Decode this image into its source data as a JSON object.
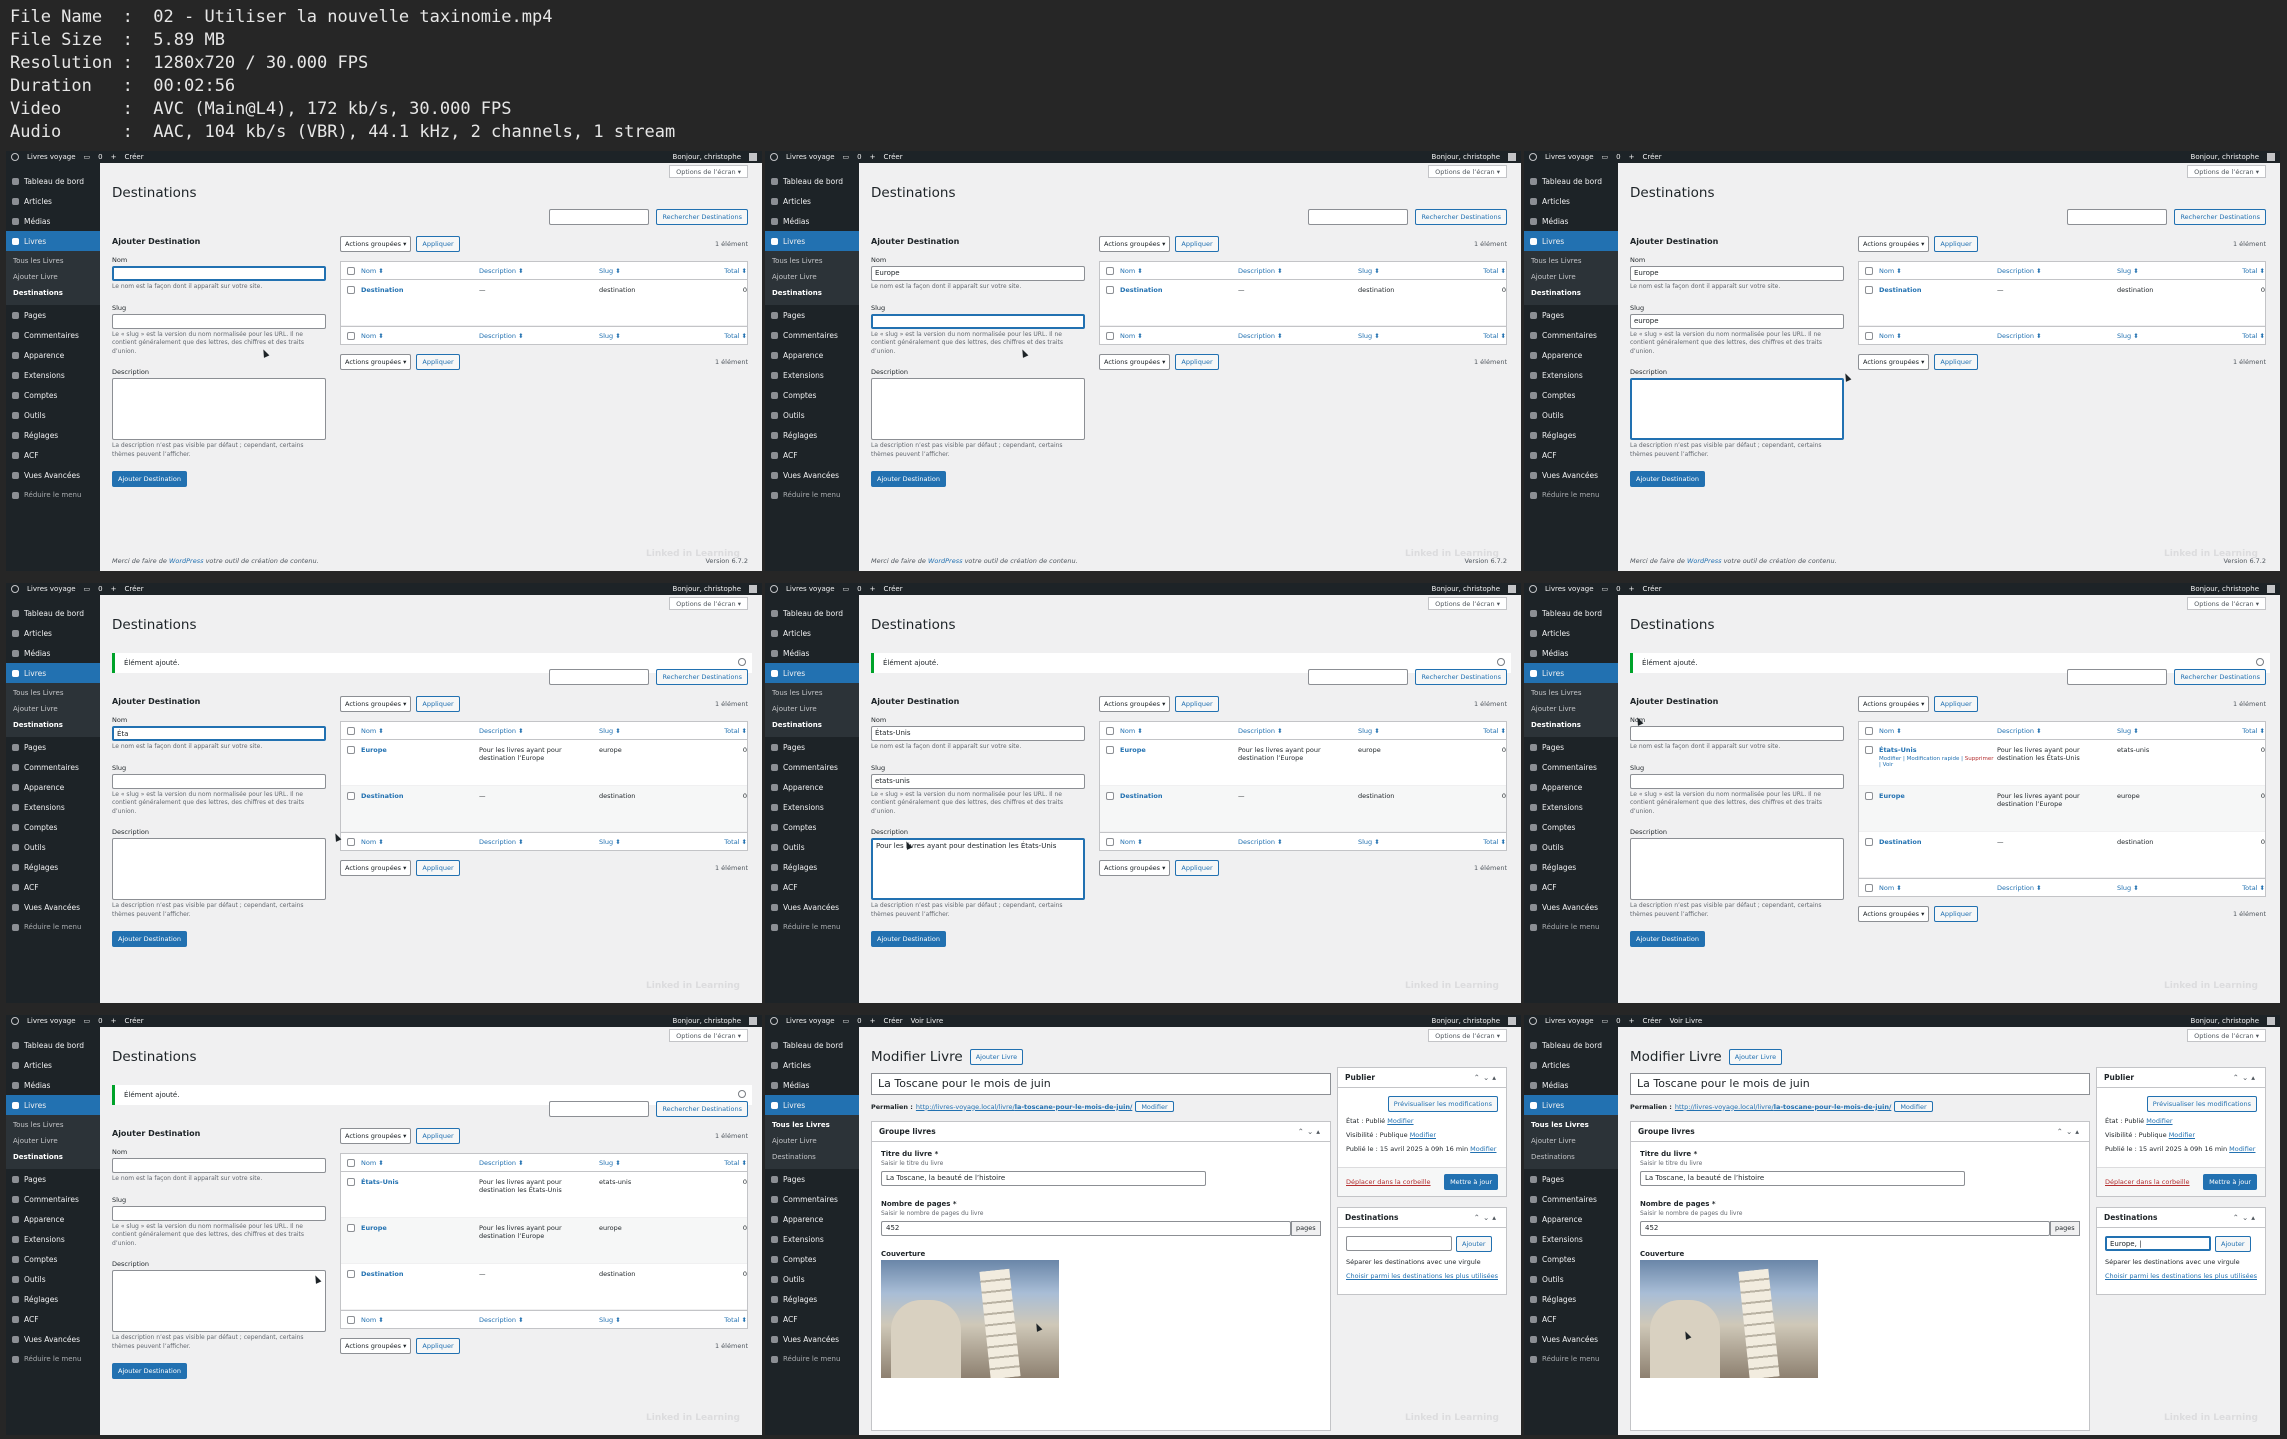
{
  "file_info": [
    {
      "label": "File Name",
      "value": "02 - Utiliser la nouvelle taxinomie.mp4"
    },
    {
      "label": "File Size",
      "value": "5.89 MB"
    },
    {
      "label": "Resolution",
      "value": "1280x720 / 30.000 FPS"
    },
    {
      "label": "Duration",
      "value": "00:02:56"
    },
    {
      "label": "Video",
      "value": "AVC (Main@L4), 172 kb/s, 30.000 FPS"
    },
    {
      "label": "Audio",
      "value": "AAC, 104 kb/s (VBR), 44.1 kHz, 2 channels, 1 stream"
    }
  ],
  "common": {
    "site_name": "Livres voyage",
    "comments_count": "0",
    "new_label": "Créer",
    "view_book": "Voir Livre",
    "greeting": "Bonjour, christophe",
    "screen_options": "Options de l’écran ▾",
    "menu": [
      "Tableau de bord",
      "Articles",
      "Médias",
      "Livres",
      "Pages",
      "Commentaires",
      "Apparence",
      "Extensions",
      "Comptes",
      "Outils",
      "Réglages",
      "ACF",
      "Vues Avancées"
    ],
    "collapse": "Réduire le menu",
    "submenu": [
      "Tous les Livres",
      "Ajouter Livre",
      "Destinations"
    ],
    "footer_pre": "Merci de faire de ",
    "footer_link": "WordPress",
    "footer_post": " votre outil de création de contenu.",
    "version": "Version 6.7.2",
    "watermark": "Linked in Learning"
  },
  "taxonomy": {
    "title": "Destinations",
    "search_button": "Rechercher Destinations",
    "notice": "Élément ajouté.",
    "add_heading": "Ajouter Destination",
    "name_label": "Nom",
    "name_help": "Le nom est la façon dont il apparaît sur votre site.",
    "slug_label": "Slug",
    "slug_help": "Le « slug » est la version du nom normalisée pour les URL. Il ne contient généralement que des lettres, des chiffres et des traits d’union.",
    "desc_label": "Description",
    "desc_help": "La description n’est pas visible par défaut ; cependant, certains thèmes peuvent l’afficher.",
    "submit": "Ajouter Destination",
    "bulk": "Actions groupées ▾",
    "apply": "Appliquer",
    "columns": [
      "Nom ⬍",
      "Description ⬍",
      "Slug ⬍",
      "Total ⬍"
    ],
    "row_actions": {
      "edit": "Modifier",
      "quick": "Modification rapide",
      "delete": "Supprimer",
      "view": "Voir"
    }
  },
  "frames": [
    {
      "notice": false,
      "name": "",
      "slug": "",
      "desc": "",
      "focus": "name",
      "count": "1 élément",
      "rows": [
        {
          "name": "Destination",
          "desc": "—",
          "slug": "destination",
          "total": "0"
        }
      ]
    },
    {
      "notice": false,
      "name": "Europe",
      "slug": "",
      "desc": "",
      "focus": "slug",
      "count": "1 élément",
      "rows": [
        {
          "name": "Destination",
          "desc": "—",
          "slug": "destination",
          "total": "0"
        }
      ]
    },
    {
      "notice": false,
      "name": "Europe",
      "slug": "europe",
      "desc": "",
      "focus": "desc",
      "count": "1 élément",
      "rows": [
        {
          "name": "Destination",
          "desc": "—",
          "slug": "destination",
          "total": "0"
        }
      ]
    },
    {
      "notice": true,
      "name": "Éta",
      "slug": "",
      "desc": "",
      "focus": "name",
      "count": "1 élément",
      "rows": [
        {
          "name": "Europe",
          "desc": "Pour les livres ayant pour destination l’Europe",
          "slug": "europe",
          "total": "0"
        },
        {
          "name": "Destination",
          "desc": "—",
          "slug": "destination",
          "total": "0"
        }
      ]
    },
    {
      "notice": true,
      "name": "États-Unis",
      "slug": "etats-unis",
      "desc": "Pour les livres ayant pour destination les États-Unis",
      "focus": "desc",
      "count": "1 élément",
      "rows": [
        {
          "name": "Europe",
          "desc": "Pour les livres ayant pour destination l’Europe",
          "slug": "europe",
          "total": "0"
        },
        {
          "name": "Destination",
          "desc": "—",
          "slug": "destination",
          "total": "0"
        }
      ]
    },
    {
      "notice": true,
      "name": "",
      "slug": "",
      "desc": "",
      "focus": "",
      "count": "1 élément",
      "rows": [
        {
          "name": "États-Unis",
          "desc": "Pour les livres ayant pour destination les États-Unis",
          "slug": "etats-unis",
          "total": "0",
          "actions": true
        },
        {
          "name": "Europe",
          "desc": "Pour les livres ayant pour destination l’Europe",
          "slug": "europe",
          "total": "0"
        },
        {
          "name": "Destination",
          "desc": "—",
          "slug": "destination",
          "total": "0"
        }
      ]
    },
    {
      "notice": true,
      "name": "",
      "slug": "",
      "desc": "",
      "focus": "",
      "count": "1 élément",
      "rows": [
        {
          "name": "États-Unis",
          "desc": "Pour les livres ayant pour destination les États-Unis",
          "slug": "etats-unis",
          "total": "0"
        },
        {
          "name": "Europe",
          "desc": "Pour les livres ayant pour destination l’Europe",
          "slug": "europe",
          "total": "0"
        },
        {
          "name": "Destination",
          "desc": "—",
          "slug": "destination",
          "total": "0"
        }
      ]
    }
  ],
  "edit": {
    "title": "Modifier Livre",
    "add_button": "Ajouter Livre",
    "post_title": "La Toscane pour le mois de juin",
    "permalink_label": "Permalien :",
    "permalink_base": "http://livres-voyage.local/livre/",
    "permalink_slug": "la-toscane-pour-le-mois-de-juin/",
    "modify": "Modifier",
    "group_title": "Groupe livres",
    "book_title_label": "Titre du livre *",
    "book_title_help": "Saisir le titre du livre",
    "book_title_value": "La Toscane, la beauté de l’histoire",
    "pages_label": "Nombre de pages *",
    "pages_help": "Saisir le nombre de pages du livre",
    "pages_value": "452",
    "pages_suffix": "pages",
    "cover_label": "Couverture",
    "publish_title": "Publier",
    "preview": "Prévisualiser les modifications",
    "status": "État : Publié",
    "visibility": "Visibilité : Publique",
    "published": "Publié le : 15 avril 2025 à 09h 16 min",
    "trash": "Déplacer dans la corbeille",
    "update": "Mettre à jour",
    "dest_title": "Destinations",
    "dest_add": "Ajouter",
    "dest_help": "Séparer les destinations avec une virgule",
    "dest_choose": "Choisir parmi les destinations les plus utilisées",
    "frames": [
      {
        "dest_value": ""
      },
      {
        "dest_value": "Europe, |"
      }
    ]
  }
}
